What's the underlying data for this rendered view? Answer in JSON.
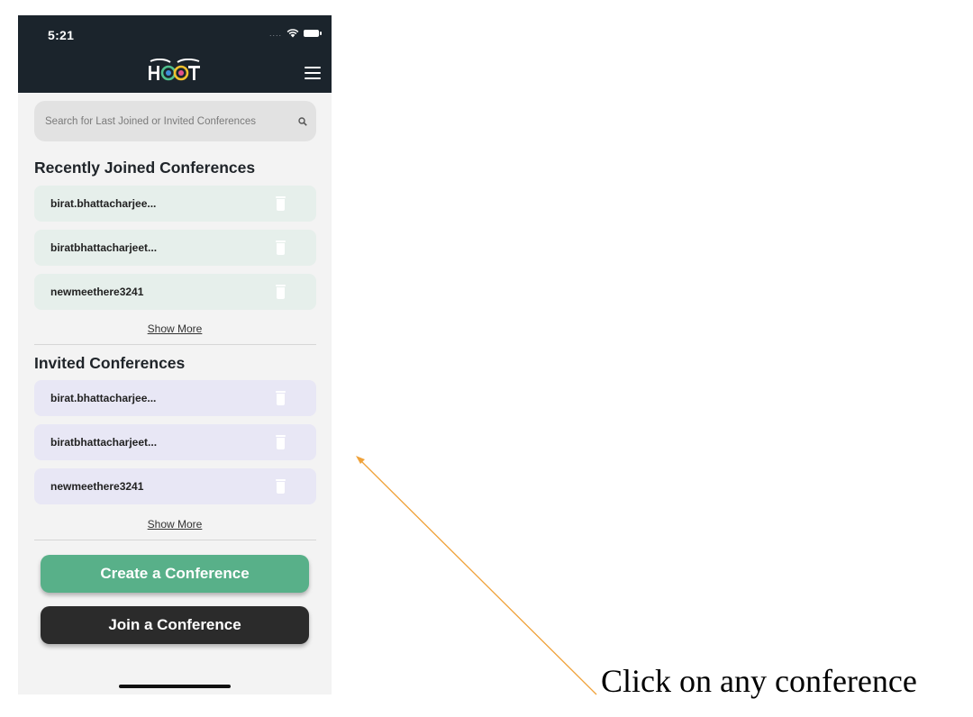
{
  "status_bar": {
    "time": "5:21",
    "signal": "....",
    "wifi_icon": "wifi-icon",
    "battery_icon": "battery-icon"
  },
  "header": {
    "logo_text": "HOOT",
    "menu_icon": "hamburger-menu-icon",
    "background": "#1b242c"
  },
  "search": {
    "placeholder": "Search for Last Joined or Invited Conferences",
    "icon": "search-icon"
  },
  "recent": {
    "title": "Recently Joined Conferences",
    "items": [
      {
        "label": "birat.bhattacharjee..."
      },
      {
        "label": "biratbhattacharjeet..."
      },
      {
        "label": "newmeethere3241"
      }
    ],
    "show_more": "Show More",
    "item_color": "#e6efeb"
  },
  "invited": {
    "title": "Invited Conferences",
    "items": [
      {
        "label": "birat.bhattacharjee..."
      },
      {
        "label": "biratbhattacharjeet..."
      },
      {
        "label": "newmeethere3241"
      }
    ],
    "show_more": "Show More",
    "item_color": "#e8e7f5"
  },
  "actions": {
    "create_label": "Create a Conference",
    "join_label": "Join a Conference",
    "create_color": "#58b089",
    "join_color": "#2b2b2b"
  },
  "annotation": {
    "text": "Click on any conference",
    "arrow_color": "#f0a23a"
  }
}
